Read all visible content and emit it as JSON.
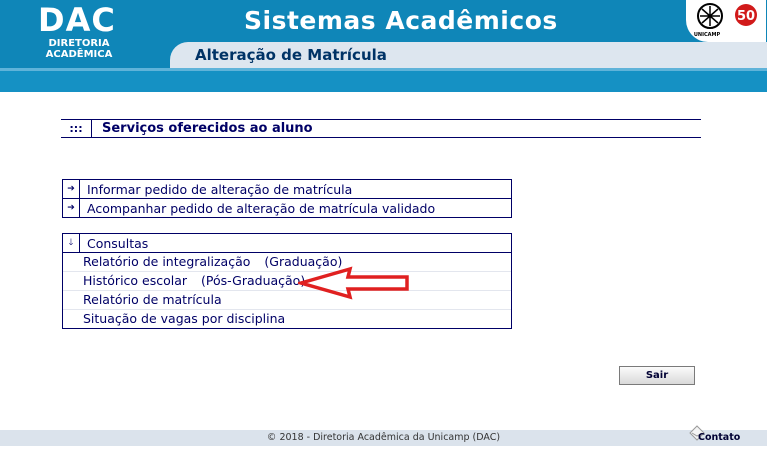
{
  "header": {
    "logo": "DAC",
    "logo_sub_line1": "DIRETORIA",
    "logo_sub_line2": "ACADÊMICA",
    "title": "Sistemas Acadêmicos",
    "subtitle": "Alteração de Matrícula",
    "unicamp_label": "UNICAMP"
  },
  "services": {
    "dots": ":::",
    "title": "Serviços oferecidos ao aluno"
  },
  "actions": [
    {
      "icon": "arrow-right",
      "label": "Informar pedido de alteração de matrícula"
    },
    {
      "icon": "arrow-right",
      "label": "Acompanhar pedido de alteração de matrícula validado"
    }
  ],
  "consultas": {
    "icon": "arrow-down",
    "header": "Consultas",
    "items": [
      {
        "label": "Relatório de integralização",
        "extra": "(Graduação)"
      },
      {
        "label": "Histórico escolar",
        "extra": "(Pós-Graduação)"
      },
      {
        "label": "Relatório de matrícula",
        "extra": ""
      },
      {
        "label": "Situação de vagas por disciplina",
        "extra": ""
      }
    ]
  },
  "buttons": {
    "sair": "Sair"
  },
  "footer": {
    "copyright": "© 2018 - Diretoria Acadêmica da Unicamp (DAC)",
    "contato": "Contato"
  },
  "colors": {
    "header_blue": "#0f86b8",
    "text_navy": "#000066",
    "annotation_red": "#e02020"
  }
}
